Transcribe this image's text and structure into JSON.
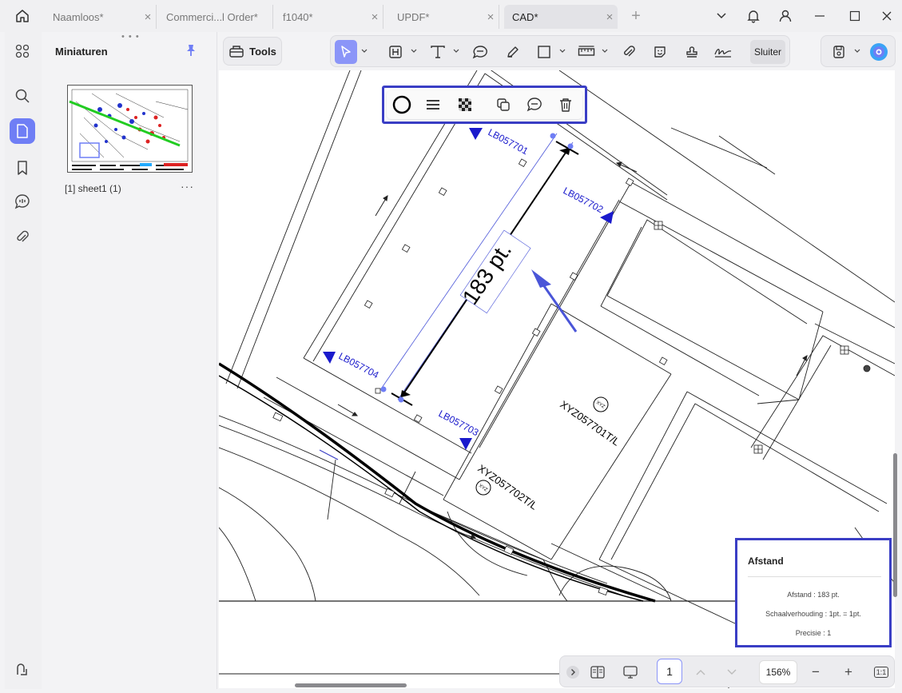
{
  "tabs": [
    {
      "label": "Naamloos*",
      "active": false
    },
    {
      "label": "Commerci...l Order*",
      "active": false
    },
    {
      "label": "f1040*",
      "active": false
    },
    {
      "label": "UPDF*",
      "active": false
    },
    {
      "label": "CAD*",
      "active": true
    }
  ],
  "new_tab_label": "+",
  "tab_close_glyph": "×",
  "panel": {
    "title": "Miniaturen",
    "grip": "• • •",
    "thumbnail_label": "[1] sheet1 (1)",
    "more": "···"
  },
  "toolbar": {
    "tools_label": "Tools",
    "sluiter_label": "Sluiter"
  },
  "drawing": {
    "measurement_label": "183 pt.",
    "labels": [
      "LB057701",
      "LB057702",
      "LB057703",
      "LB057704",
      "XYZ057701T/L",
      "XYZ057702T/L",
      "XYZ",
      "XYZ"
    ]
  },
  "measure": {
    "title": "Afstand",
    "distance": "Afstand : 183 pt.",
    "scale": "Schaalverhouding : 1pt. = 1pt.",
    "precision": "Precisie : 1"
  },
  "nav": {
    "page_number": "1",
    "zoom": "156%",
    "zoom_out": "−",
    "zoom_in": "+",
    "fit": "1:1"
  },
  "colors": {
    "accent": "#6f7ef5",
    "annotation_blue": "#3a3ec5",
    "label_blue": "#1a1acc"
  },
  "icons": [
    "home-icon",
    "chevron-down-icon",
    "bell-icon",
    "user-icon",
    "minimize-icon",
    "maximize-icon",
    "close-icon",
    "grid-icon",
    "search-icon",
    "pages-icon",
    "bookmark-icon",
    "comment-icon",
    "attachment-icon",
    "updf-logo-icon",
    "pin-icon",
    "toolbox-icon",
    "cursor-icon",
    "highlight-icon",
    "text-icon",
    "comment-bubble-icon",
    "pencil-icon",
    "rectangle-icon",
    "measure-icon",
    "paperclip-icon",
    "sticker-icon",
    "stamp-icon",
    "signature-icon",
    "save-icon",
    "ai-assistant-icon",
    "circle-icon",
    "line-style-icon",
    "opacity-icon",
    "copy-icon",
    "comment-icon",
    "trash-icon"
  ]
}
